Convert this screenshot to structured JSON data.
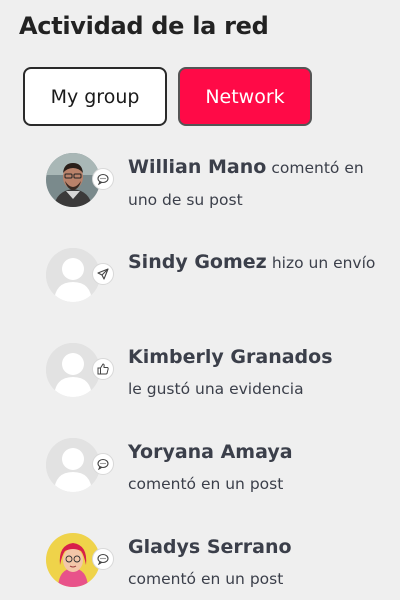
{
  "page": {
    "title": "Actividad de la red"
  },
  "tabs": [
    {
      "label": "My group",
      "active": false
    },
    {
      "label": "Network",
      "active": true
    }
  ],
  "colors": {
    "accent": "#ff0a47",
    "background": "#efefef"
  },
  "activity": [
    {
      "name": "Willian Mano",
      "action": "comentó en uno de su post",
      "icon": "comment-icon",
      "avatar": "photo"
    },
    {
      "name": "Sindy Gomez",
      "action": "hizo un envío",
      "icon": "send-icon",
      "avatar": "placeholder"
    },
    {
      "name": "Kimberly Granados",
      "action": "le gustó una evidencia",
      "icon": "thumbs-up-icon",
      "avatar": "placeholder"
    },
    {
      "name": "Yoryana Amaya",
      "action": "comentó en un post",
      "icon": "comment-icon",
      "avatar": "placeholder"
    },
    {
      "name": "Gladys Serrano",
      "action": "comentó en un post",
      "icon": "comment-icon",
      "avatar": "illustration"
    }
  ]
}
